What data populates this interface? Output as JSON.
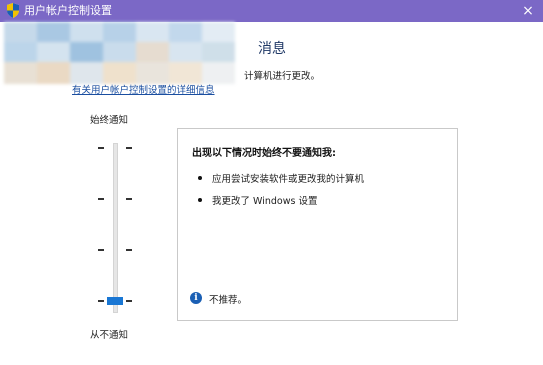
{
  "window": {
    "title": "用户帐户控制设置",
    "titlebar_color": "#7b68c6",
    "close_glyph": "×"
  },
  "header": {
    "heading_visible_part": "消息",
    "description_visible_part": "计算机进行更改。",
    "details_link": "有关用户帐户控制设置的详细信息",
    "redacted": true
  },
  "slider": {
    "top_label": "始终通知",
    "bottom_label": "从不通知",
    "levels": 4,
    "selected_level": 1,
    "thumb_color": "#1a77d4"
  },
  "info_panel": {
    "title": "出现以下情况时始终不要通知我:",
    "bullets": [
      "应用尝试安装软件或更改我的计算机",
      "我更改了 Windows 设置"
    ],
    "note_icon": "info-icon",
    "note": "不推荐。"
  }
}
